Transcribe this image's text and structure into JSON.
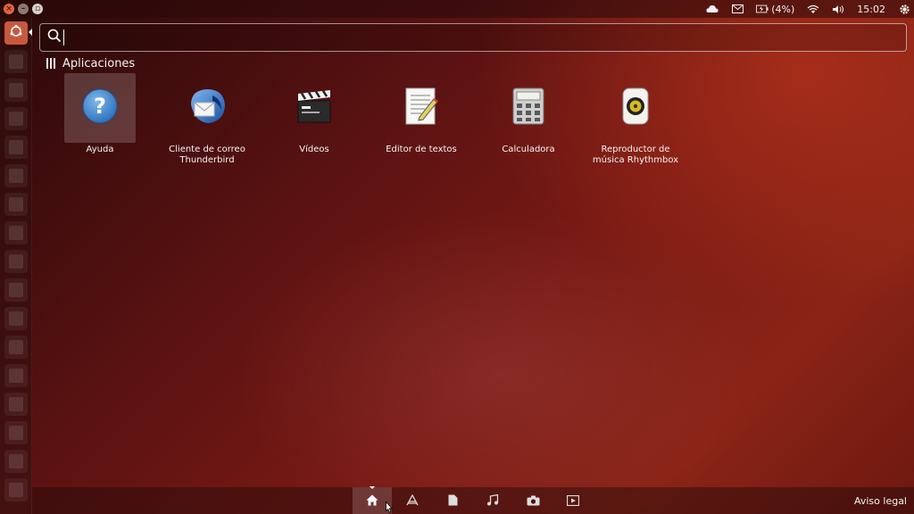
{
  "top_panel": {
    "battery_text": "(4%)",
    "clock": "15:02",
    "icons": [
      "cloud-icon",
      "mail-icon",
      "battery-icon",
      "wifi-icon",
      "volume-icon",
      "gear-icon"
    ]
  },
  "search": {
    "value": "",
    "placeholder": ""
  },
  "category": {
    "label": "Aplicaciones"
  },
  "apps": [
    {
      "label": "Ayuda",
      "icon": "help-icon"
    },
    {
      "label": "Cliente de correo Thunderbird",
      "icon": "thunderbird-icon"
    },
    {
      "label": "Vídeos",
      "icon": "videos-icon"
    },
    {
      "label": "Editor de textos",
      "icon": "text-editor-icon"
    },
    {
      "label": "Calculadora",
      "icon": "calculator-icon"
    },
    {
      "label": "Reproductor de música Rhythmbox",
      "icon": "rhythmbox-icon"
    }
  ],
  "bottom_bar": {
    "lenses": [
      "home-lens-icon",
      "applications-lens-icon",
      "files-lens-icon",
      "music-lens-icon",
      "photos-lens-icon",
      "videos-lens-icon"
    ],
    "legal_label": "Aviso legal"
  },
  "colors": {
    "accent": "#c8593d",
    "panel": "#2a0a0a"
  }
}
